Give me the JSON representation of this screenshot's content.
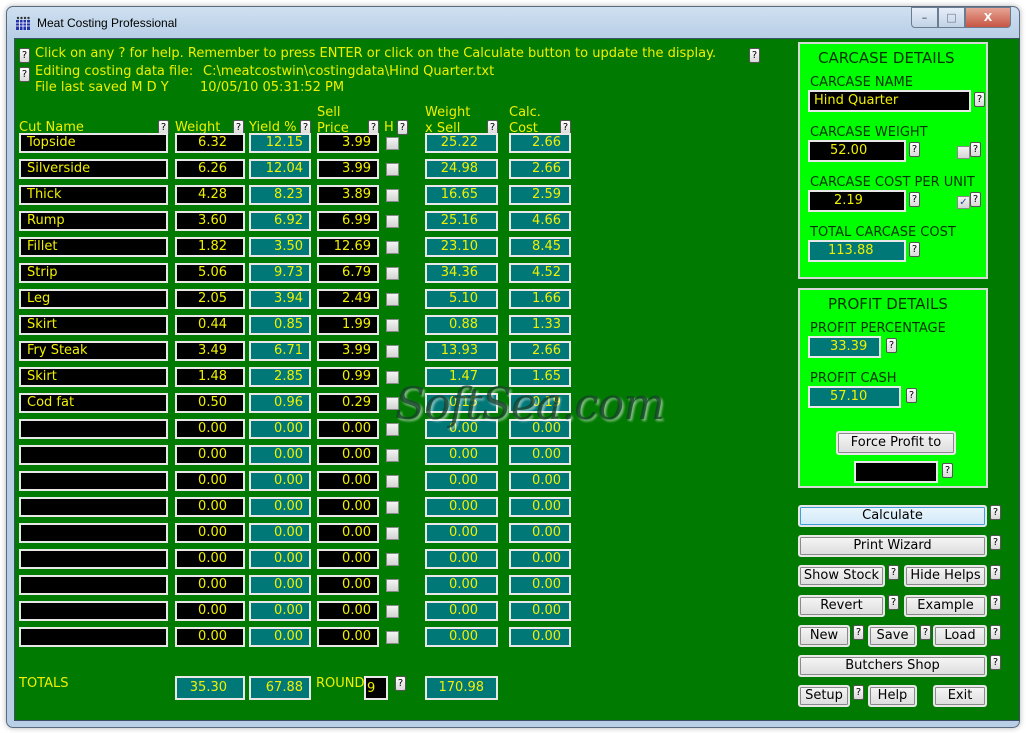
{
  "window": {
    "title": "Meat Costing Professional",
    "icon": "app-grid-icon",
    "controls": {
      "minimize": "–",
      "maximize": "□",
      "close": "X"
    }
  },
  "header": {
    "help_line": "Click on any ? for help. Remember to press ENTER or click on the Calculate button to update the display.",
    "file_label": "Editing costing data file:",
    "file_path": "C:\\meatcostwin\\costingdata\\Hind Quarter.txt",
    "saved_label": "File last saved M D Y",
    "saved_value": "10/05/10 05:31:52 PM"
  },
  "help_glyph": "?",
  "columns": {
    "cut_name": "Cut Name",
    "weight": "Weight",
    "yield": "Yield %",
    "sell_price_1": "Sell",
    "sell_price_2": "Price",
    "h": "H",
    "wxs_1": "Weight",
    "wxs_2": "x Sell",
    "calc_1": "Calc.",
    "calc_2": "Cost"
  },
  "rows": [
    {
      "name": "Topside",
      "weight": "6.32",
      "yield": "12.15",
      "price": "3.99",
      "h": false,
      "wxs": "25.22",
      "cost": "2.66"
    },
    {
      "name": "Silverside",
      "weight": "6.26",
      "yield": "12.04",
      "price": "3.99",
      "h": false,
      "wxs": "24.98",
      "cost": "2.66"
    },
    {
      "name": "Thick",
      "weight": "4.28",
      "yield": "8.23",
      "price": "3.89",
      "h": false,
      "wxs": "16.65",
      "cost": "2.59"
    },
    {
      "name": "Rump",
      "weight": "3.60",
      "yield": "6.92",
      "price": "6.99",
      "h": false,
      "wxs": "25.16",
      "cost": "4.66"
    },
    {
      "name": "Fillet",
      "weight": "1.82",
      "yield": "3.50",
      "price": "12.69",
      "h": false,
      "wxs": "23.10",
      "cost": "8.45"
    },
    {
      "name": "Strip",
      "weight": "5.06",
      "yield": "9.73",
      "price": "6.79",
      "h": false,
      "wxs": "34.36",
      "cost": "4.52"
    },
    {
      "name": "Leg",
      "weight": "2.05",
      "yield": "3.94",
      "price": "2.49",
      "h": false,
      "wxs": "5.10",
      "cost": "1.66"
    },
    {
      "name": "Skirt",
      "weight": "0.44",
      "yield": "0.85",
      "price": "1.99",
      "h": false,
      "wxs": "0.88",
      "cost": "1.33"
    },
    {
      "name": "Fry Steak",
      "weight": "3.49",
      "yield": "6.71",
      "price": "3.99",
      "h": false,
      "wxs": "13.93",
      "cost": "2.66"
    },
    {
      "name": "Skirt",
      "weight": "1.48",
      "yield": "2.85",
      "price": "0.99",
      "h": false,
      "wxs": "1.47",
      "cost": "1.65"
    },
    {
      "name": "Cod fat",
      "weight": "0.50",
      "yield": "0.96",
      "price": "0.29",
      "h": false,
      "wxs": "0.15",
      "cost": "0.19"
    },
    {
      "name": "",
      "weight": "0.00",
      "yield": "0.00",
      "price": "0.00",
      "h": false,
      "wxs": "0.00",
      "cost": "0.00"
    },
    {
      "name": "",
      "weight": "0.00",
      "yield": "0.00",
      "price": "0.00",
      "h": false,
      "wxs": "0.00",
      "cost": "0.00"
    },
    {
      "name": "",
      "weight": "0.00",
      "yield": "0.00",
      "price": "0.00",
      "h": false,
      "wxs": "0.00",
      "cost": "0.00"
    },
    {
      "name": "",
      "weight": "0.00",
      "yield": "0.00",
      "price": "0.00",
      "h": false,
      "wxs": "0.00",
      "cost": "0.00"
    },
    {
      "name": "",
      "weight": "0.00",
      "yield": "0.00",
      "price": "0.00",
      "h": false,
      "wxs": "0.00",
      "cost": "0.00"
    },
    {
      "name": "",
      "weight": "0.00",
      "yield": "0.00",
      "price": "0.00",
      "h": false,
      "wxs": "0.00",
      "cost": "0.00"
    },
    {
      "name": "",
      "weight": "0.00",
      "yield": "0.00",
      "price": "0.00",
      "h": false,
      "wxs": "0.00",
      "cost": "0.00"
    },
    {
      "name": "",
      "weight": "0.00",
      "yield": "0.00",
      "price": "0.00",
      "h": false,
      "wxs": "0.00",
      "cost": "0.00"
    },
    {
      "name": "",
      "weight": "0.00",
      "yield": "0.00",
      "price": "0.00",
      "h": false,
      "wxs": "0.00",
      "cost": "0.00"
    }
  ],
  "totals": {
    "label": "TOTALS",
    "weight": "35.30",
    "yield": "67.88",
    "round_label": "ROUND",
    "round_value": "9",
    "wxs": "170.98"
  },
  "carcase": {
    "heading": "CARCASE DETAILS",
    "name_label": "CARCASE NAME",
    "name_value": "Hind Quarter",
    "weight_label": "CARCASE WEIGHT",
    "weight_value": "52.00",
    "weight_checkbox": false,
    "cost_unit_label": "CARCASE COST PER UNIT",
    "cost_unit_value": "2.19",
    "cost_unit_checkbox": true,
    "total_label": "TOTAL CARCASE COST",
    "total_value": "113.88"
  },
  "profit": {
    "heading": "PROFIT DETAILS",
    "percent_label": "PROFIT PERCENTAGE",
    "percent_value": "33.39",
    "cash_label": "PROFIT CASH",
    "cash_value": "57.10",
    "force_button": "Force Profit to",
    "force_value": ""
  },
  "buttons": {
    "calculate": "Calculate",
    "print_wizard": "Print Wizard",
    "show_stock": "Show Stock",
    "hide_helps": "Hide Helps",
    "revert": "Revert",
    "example": "Example",
    "new": "New",
    "save": "Save",
    "load": "Load",
    "butchers_shop": "Butchers Shop",
    "setup": "Setup",
    "help": "Help",
    "exit": "Exit"
  },
  "watermark": "SoftSea.com",
  "colors": {
    "background": "#007a00",
    "panel": "#00ff00",
    "text": "#f0f000",
    "input_black": "#000000",
    "readonly_teal": "#007878"
  }
}
